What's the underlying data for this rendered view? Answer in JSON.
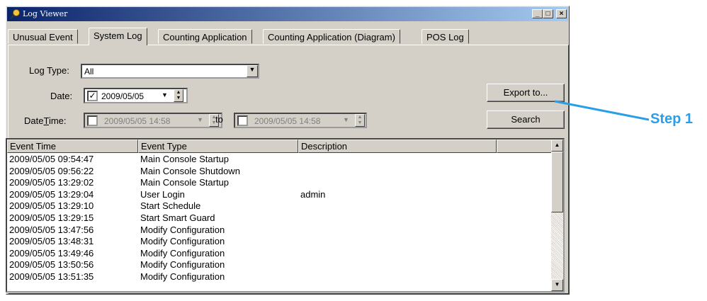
{
  "window": {
    "title": "Log Viewer",
    "controls": [
      "minimize",
      "maximize",
      "close"
    ]
  },
  "tabs": [
    {
      "label": "Unusual Event",
      "active": false
    },
    {
      "label": "System Log",
      "active": true
    },
    {
      "label": "Counting Application",
      "active": false
    },
    {
      "label": "Counting Application (Diagram)",
      "active": false
    },
    {
      "label": "POS Log",
      "active": false
    }
  ],
  "filters": {
    "log_type_label": "Log Type:",
    "log_type_value": "All",
    "date_label": "Date:",
    "date_checked": true,
    "date_value": "2009/05/05",
    "datetime_label_pre": "Date",
    "datetime_label_u": "T",
    "datetime_label_post": "ime:",
    "datetime_from_checked": false,
    "datetime_from": "2009/05/05 14:58",
    "to_label": "to",
    "datetime_to_checked": false,
    "datetime_to": "2009/05/05 14:58"
  },
  "buttons": {
    "export": "Export to...",
    "search": "Search"
  },
  "table": {
    "columns": [
      "Event Time",
      "Event Type",
      "Description"
    ],
    "rows": [
      [
        "2009/05/05 09:54:47",
        "Main Console Startup",
        ""
      ],
      [
        "2009/05/05 09:56:22",
        "Main Console Shutdown",
        ""
      ],
      [
        "2009/05/05 13:29:02",
        "Main Console Startup",
        ""
      ],
      [
        "2009/05/05 13:29:04",
        "User Login",
        "admin"
      ],
      [
        "2009/05/05 13:29:10",
        "Start Schedule",
        ""
      ],
      [
        "2009/05/05 13:29:15",
        "Start Smart Guard",
        ""
      ],
      [
        "2009/05/05 13:47:56",
        "Modify Configuration",
        ""
      ],
      [
        "2009/05/05 13:48:31",
        "Modify Configuration",
        ""
      ],
      [
        "2009/05/05 13:49:46",
        "Modify Configuration",
        ""
      ],
      [
        "2009/05/05 13:50:56",
        "Modify Configuration",
        ""
      ],
      [
        "2009/05/05 13:51:35",
        "Modify Configuration",
        ""
      ]
    ]
  },
  "annotation": {
    "label": "Step 1",
    "color": "#2a9fe8"
  }
}
